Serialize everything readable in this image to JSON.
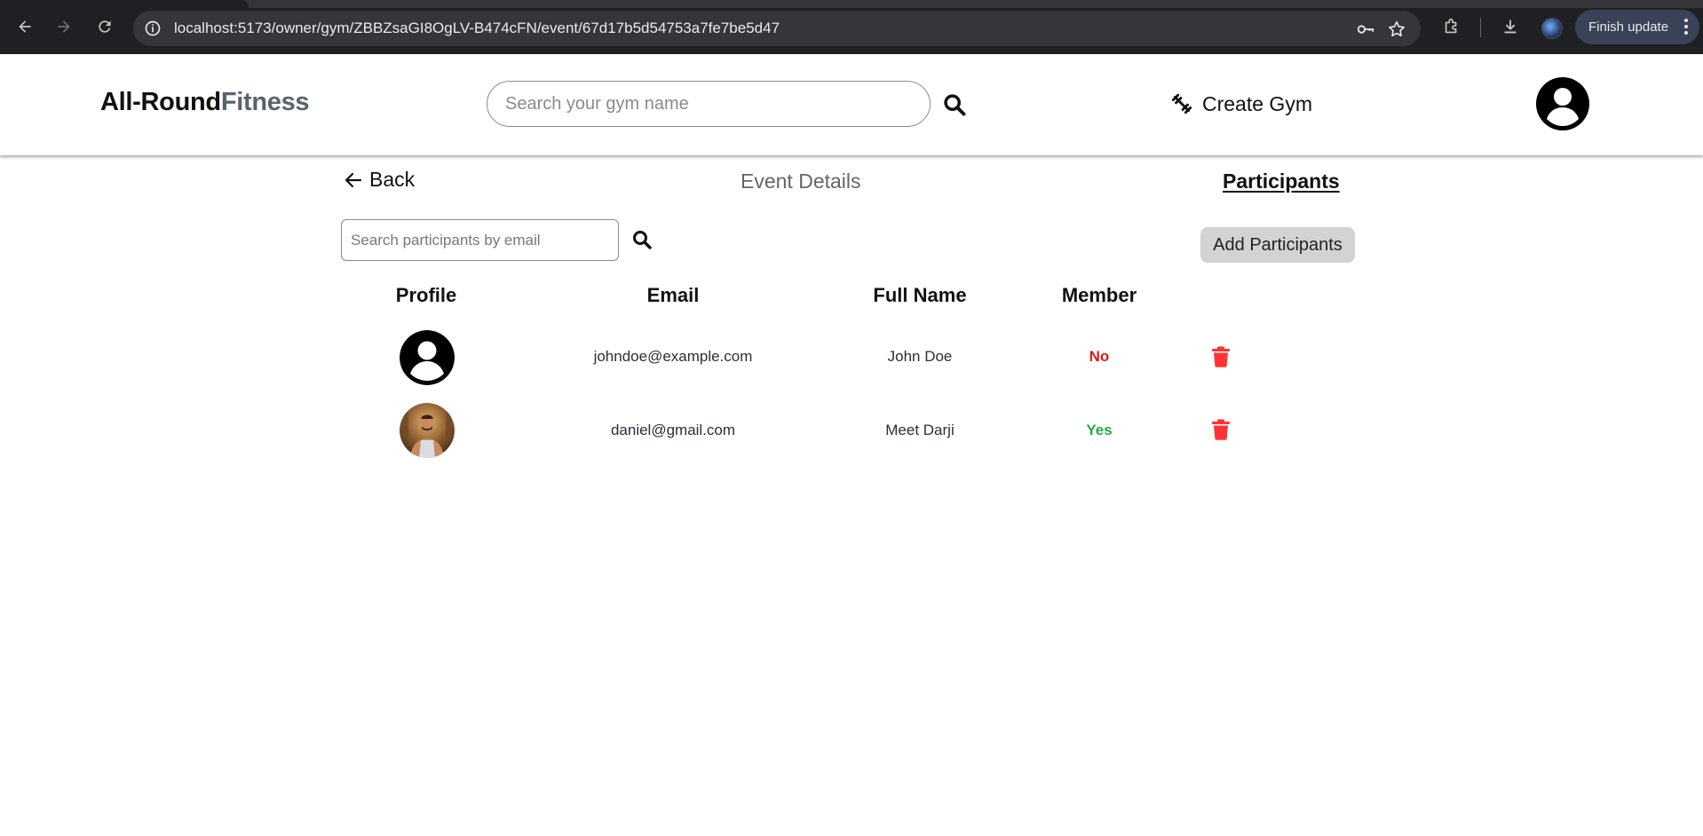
{
  "browser": {
    "url": "localhost:5173/owner/gym/ZBBZsaGI8OgLV-B474cFN/event/67d17b5d54753a7fe7be5d47",
    "update_button": "Finish update"
  },
  "header": {
    "logo_part1": "All-Round",
    "logo_part2": "Fitness",
    "search_placeholder": "Search your gym name",
    "create_gym_label": "Create Gym"
  },
  "nav": {
    "back_label": "Back",
    "event_details_label": "Event Details",
    "participants_label": "Participants"
  },
  "participants": {
    "search_placeholder": "Search participants by email",
    "add_button": "Add Participants",
    "columns": [
      "Profile",
      "Email",
      "Full Name",
      "Member"
    ],
    "rows": [
      {
        "email": "johndoe@example.com",
        "full_name": "John Doe",
        "member": "No",
        "avatar": "default-user-icon"
      },
      {
        "email": "daniel@gmail.com",
        "full_name": "Meet Darji",
        "member": "Yes",
        "avatar": "user-photo"
      }
    ]
  },
  "colors": {
    "member_no": "#e0191a",
    "member_yes": "#27a845",
    "delete": "#ff3333",
    "logo_accent": "#5a6270"
  }
}
